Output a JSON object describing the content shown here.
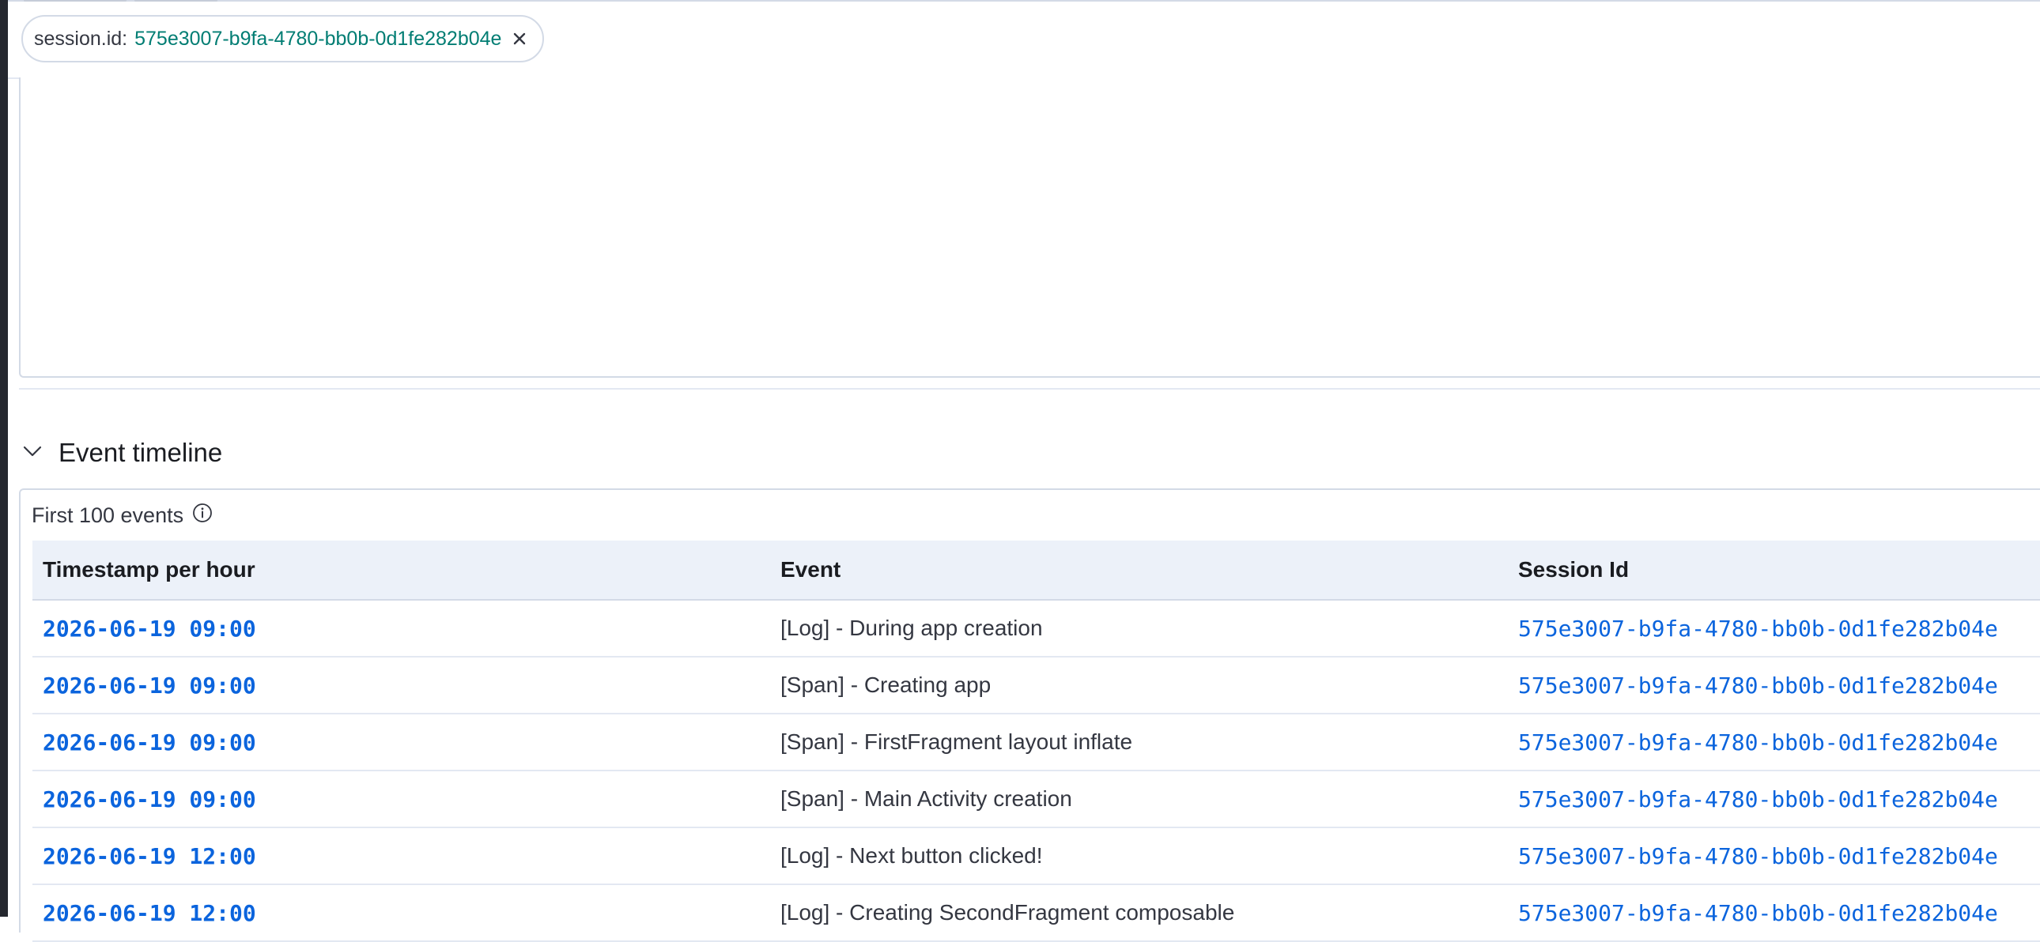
{
  "filter": {
    "key_label": "session.id:",
    "value": "575e3007-b9fa-4780-bb0b-0d1fe282b04e"
  },
  "section": {
    "title": "Event timeline"
  },
  "events": {
    "caption": "First 100 events",
    "columns": [
      "Timestamp per hour",
      "Event",
      "Session Id"
    ],
    "rows": [
      {
        "timestamp": "2026-06-19 09:00",
        "event": "[Log] - During app creation",
        "session_id": "575e3007-b9fa-4780-bb0b-0d1fe282b04e"
      },
      {
        "timestamp": "2026-06-19 09:00",
        "event": "[Span] - Creating app",
        "session_id": "575e3007-b9fa-4780-bb0b-0d1fe282b04e"
      },
      {
        "timestamp": "2026-06-19 09:00",
        "event": "[Span] - FirstFragment layout inflate",
        "session_id": "575e3007-b9fa-4780-bb0b-0d1fe282b04e"
      },
      {
        "timestamp": "2026-06-19 09:00",
        "event": "[Span] - Main Activity creation",
        "session_id": "575e3007-b9fa-4780-bb0b-0d1fe282b04e"
      },
      {
        "timestamp": "2026-06-19 12:00",
        "event": "[Log] - Next button clicked!",
        "session_id": "575e3007-b9fa-4780-bb0b-0d1fe282b04e"
      },
      {
        "timestamp": "2026-06-19 12:00",
        "event": "[Log] - Creating SecondFragment composable",
        "session_id": "575e3007-b9fa-4780-bb0b-0d1fe282b04e"
      }
    ]
  },
  "colors": {
    "link": "#0b64dd",
    "filter_value": "#017d73",
    "table_header_bg": "#ecf1f9"
  },
  "icons": {
    "pill_close": "close-icon",
    "section_toggle": "chevron-down-icon",
    "caption_info": "info-icon"
  }
}
